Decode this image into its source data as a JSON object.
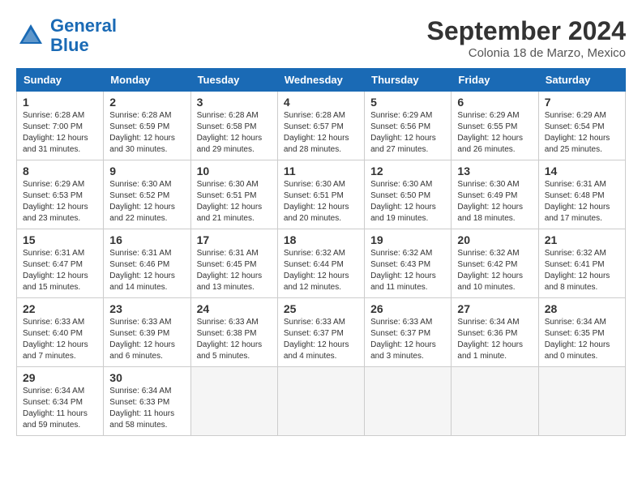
{
  "header": {
    "logo_general": "General",
    "logo_blue": "Blue",
    "month_title": "September 2024",
    "subtitle": "Colonia 18 de Marzo, Mexico"
  },
  "weekdays": [
    "Sunday",
    "Monday",
    "Tuesday",
    "Wednesday",
    "Thursday",
    "Friday",
    "Saturday"
  ],
  "weeks": [
    [
      {
        "day": "1",
        "info": "Sunrise: 6:28 AM\nSunset: 7:00 PM\nDaylight: 12 hours\nand 31 minutes."
      },
      {
        "day": "2",
        "info": "Sunrise: 6:28 AM\nSunset: 6:59 PM\nDaylight: 12 hours\nand 30 minutes."
      },
      {
        "day": "3",
        "info": "Sunrise: 6:28 AM\nSunset: 6:58 PM\nDaylight: 12 hours\nand 29 minutes."
      },
      {
        "day": "4",
        "info": "Sunrise: 6:28 AM\nSunset: 6:57 PM\nDaylight: 12 hours\nand 28 minutes."
      },
      {
        "day": "5",
        "info": "Sunrise: 6:29 AM\nSunset: 6:56 PM\nDaylight: 12 hours\nand 27 minutes."
      },
      {
        "day": "6",
        "info": "Sunrise: 6:29 AM\nSunset: 6:55 PM\nDaylight: 12 hours\nand 26 minutes."
      },
      {
        "day": "7",
        "info": "Sunrise: 6:29 AM\nSunset: 6:54 PM\nDaylight: 12 hours\nand 25 minutes."
      }
    ],
    [
      {
        "day": "8",
        "info": "Sunrise: 6:29 AM\nSunset: 6:53 PM\nDaylight: 12 hours\nand 23 minutes."
      },
      {
        "day": "9",
        "info": "Sunrise: 6:30 AM\nSunset: 6:52 PM\nDaylight: 12 hours\nand 22 minutes."
      },
      {
        "day": "10",
        "info": "Sunrise: 6:30 AM\nSunset: 6:51 PM\nDaylight: 12 hours\nand 21 minutes."
      },
      {
        "day": "11",
        "info": "Sunrise: 6:30 AM\nSunset: 6:51 PM\nDaylight: 12 hours\nand 20 minutes."
      },
      {
        "day": "12",
        "info": "Sunrise: 6:30 AM\nSunset: 6:50 PM\nDaylight: 12 hours\nand 19 minutes."
      },
      {
        "day": "13",
        "info": "Sunrise: 6:30 AM\nSunset: 6:49 PM\nDaylight: 12 hours\nand 18 minutes."
      },
      {
        "day": "14",
        "info": "Sunrise: 6:31 AM\nSunset: 6:48 PM\nDaylight: 12 hours\nand 17 minutes."
      }
    ],
    [
      {
        "day": "15",
        "info": "Sunrise: 6:31 AM\nSunset: 6:47 PM\nDaylight: 12 hours\nand 15 minutes."
      },
      {
        "day": "16",
        "info": "Sunrise: 6:31 AM\nSunset: 6:46 PM\nDaylight: 12 hours\nand 14 minutes."
      },
      {
        "day": "17",
        "info": "Sunrise: 6:31 AM\nSunset: 6:45 PM\nDaylight: 12 hours\nand 13 minutes."
      },
      {
        "day": "18",
        "info": "Sunrise: 6:32 AM\nSunset: 6:44 PM\nDaylight: 12 hours\nand 12 minutes."
      },
      {
        "day": "19",
        "info": "Sunrise: 6:32 AM\nSunset: 6:43 PM\nDaylight: 12 hours\nand 11 minutes."
      },
      {
        "day": "20",
        "info": "Sunrise: 6:32 AM\nSunset: 6:42 PM\nDaylight: 12 hours\nand 10 minutes."
      },
      {
        "day": "21",
        "info": "Sunrise: 6:32 AM\nSunset: 6:41 PM\nDaylight: 12 hours\nand 8 minutes."
      }
    ],
    [
      {
        "day": "22",
        "info": "Sunrise: 6:33 AM\nSunset: 6:40 PM\nDaylight: 12 hours\nand 7 minutes."
      },
      {
        "day": "23",
        "info": "Sunrise: 6:33 AM\nSunset: 6:39 PM\nDaylight: 12 hours\nand 6 minutes."
      },
      {
        "day": "24",
        "info": "Sunrise: 6:33 AM\nSunset: 6:38 PM\nDaylight: 12 hours\nand 5 minutes."
      },
      {
        "day": "25",
        "info": "Sunrise: 6:33 AM\nSunset: 6:37 PM\nDaylight: 12 hours\nand 4 minutes."
      },
      {
        "day": "26",
        "info": "Sunrise: 6:33 AM\nSunset: 6:37 PM\nDaylight: 12 hours\nand 3 minutes."
      },
      {
        "day": "27",
        "info": "Sunrise: 6:34 AM\nSunset: 6:36 PM\nDaylight: 12 hours\nand 1 minute."
      },
      {
        "day": "28",
        "info": "Sunrise: 6:34 AM\nSunset: 6:35 PM\nDaylight: 12 hours\nand 0 minutes."
      }
    ],
    [
      {
        "day": "29",
        "info": "Sunrise: 6:34 AM\nSunset: 6:34 PM\nDaylight: 11 hours\nand 59 minutes."
      },
      {
        "day": "30",
        "info": "Sunrise: 6:34 AM\nSunset: 6:33 PM\nDaylight: 11 hours\nand 58 minutes."
      },
      {
        "day": "",
        "info": ""
      },
      {
        "day": "",
        "info": ""
      },
      {
        "day": "",
        "info": ""
      },
      {
        "day": "",
        "info": ""
      },
      {
        "day": "",
        "info": ""
      }
    ]
  ]
}
